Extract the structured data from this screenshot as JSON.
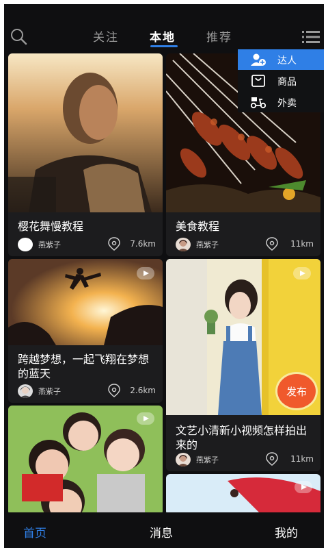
{
  "header": {
    "tabs": [
      {
        "label": "关注"
      },
      {
        "label": "本地"
      },
      {
        "label": "推荐"
      }
    ],
    "active_tab": "本地",
    "search_icon": "search-icon",
    "menu_icon": "menu-icon"
  },
  "dropdown": {
    "items": [
      {
        "label": "达人",
        "icon": "add-user-icon",
        "selected": true
      },
      {
        "label": "商品",
        "icon": "shopping-bag-icon",
        "selected": false
      },
      {
        "label": "外卖",
        "icon": "delivery-scooter-icon",
        "selected": false
      }
    ]
  },
  "feed": {
    "cards": [
      {
        "title": "樱花舞慢教程",
        "author": "燕紫子",
        "distance": "7.6km"
      },
      {
        "title": "美食教程",
        "author": "燕紫子",
        "distance": "11km"
      },
      {
        "title": "跨越梦想，一起飞翔在梦想的蓝天",
        "author": "燕紫子",
        "distance": "2.6km"
      },
      {
        "title": "文艺小清新小视频怎样拍出来的",
        "author": "燕紫子",
        "distance": "11km"
      }
    ]
  },
  "publish": {
    "label": "发布"
  },
  "bottom_nav": {
    "items": [
      {
        "label": "首页",
        "active": true
      },
      {
        "label": "消息",
        "active": false
      },
      {
        "label": "我的",
        "active": false
      }
    ]
  },
  "colors": {
    "accent": "#2f7fe6",
    "publish": "#f0592c",
    "background": "#0f0f11",
    "card": "#1c1c1e"
  }
}
